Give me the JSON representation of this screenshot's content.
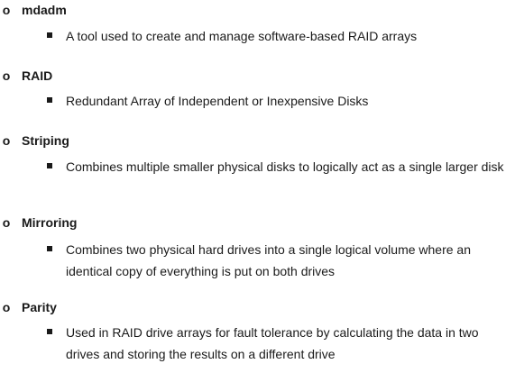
{
  "items": [
    {
      "term": "mdadm",
      "definition": "A tool used to create and manage software-based RAID arrays"
    },
    {
      "term": "RAID",
      "definition": "Redundant Array of Independent or Inexpensive Disks"
    },
    {
      "term": "Striping",
      "definition": "Combines multiple smaller physical disks to logically act as a single larger disk"
    },
    {
      "term": "Mirroring",
      "definition": "Combines two physical hard drives into a single logical volume where an identical copy of everything is put on both drives"
    },
    {
      "term": "Parity",
      "definition": "Used in RAID drive arrays for fault tolerance by calculating the data in two drives and storing the results on a different drive"
    }
  ]
}
